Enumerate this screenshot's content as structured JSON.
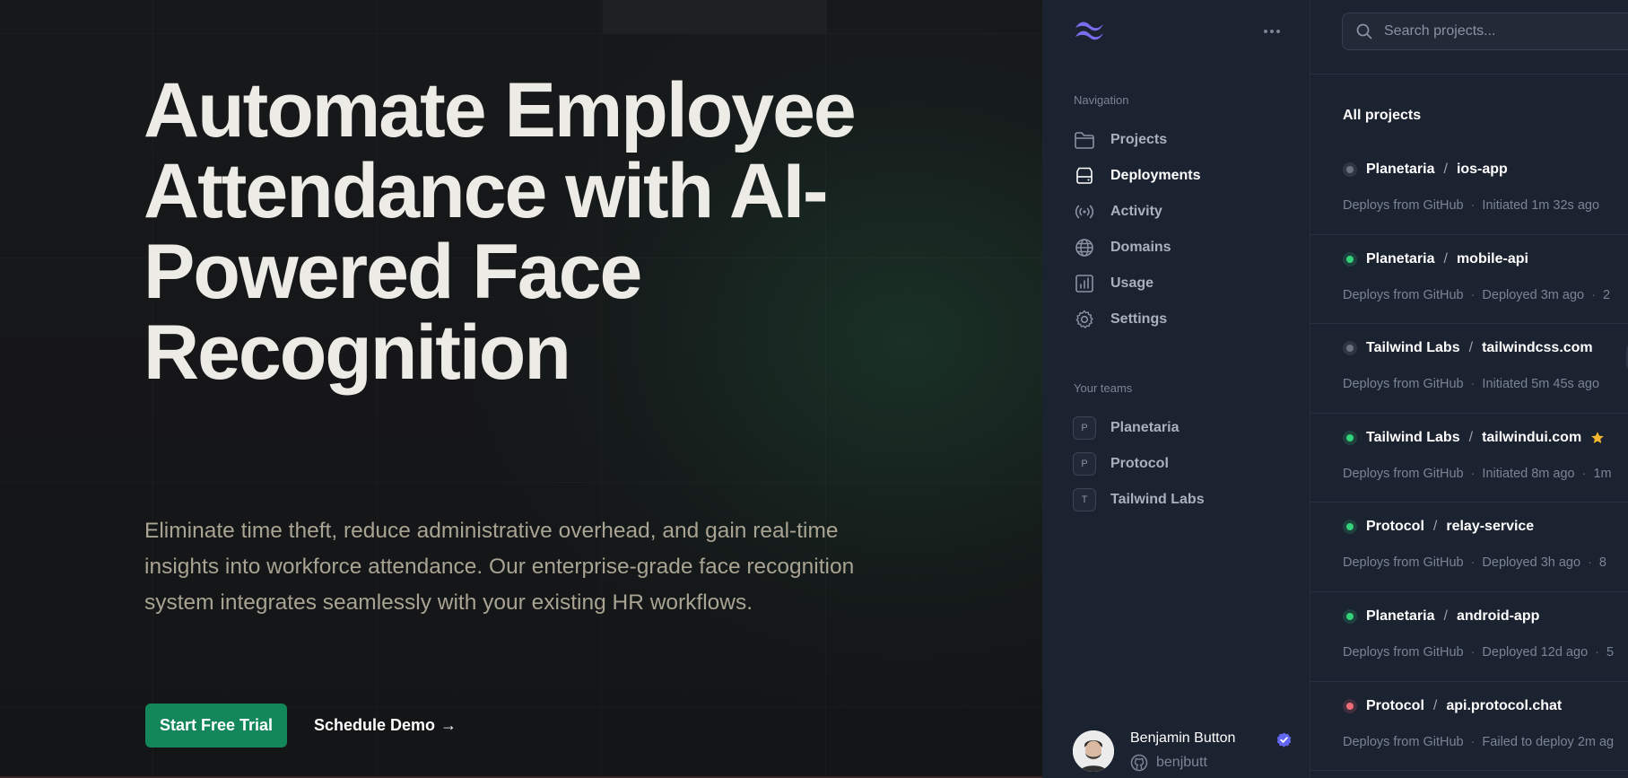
{
  "hero": {
    "title": "Automate Employee Attendance with AI-Powered Face Recognition",
    "subtitle": "Eliminate time theft, reduce administrative overhead, and gain real-time insights into workforce attendance. Our enterprise-grade face recognition system integrates seamlessly with your existing HR workflows.",
    "primary_cta": "Start Free Trial",
    "secondary_cta": "Schedule Demo",
    "secondary_cta_arrow": "→"
  },
  "sidebar": {
    "navigation_label": "Navigation",
    "nav_items": [
      {
        "label": "Projects",
        "icon": "folder-icon"
      },
      {
        "label": "Deployments",
        "icon": "server-icon",
        "active": true
      },
      {
        "label": "Activity",
        "icon": "signal-icon"
      },
      {
        "label": "Domains",
        "icon": "globe-icon"
      },
      {
        "label": "Usage",
        "icon": "chart-icon"
      },
      {
        "label": "Settings",
        "icon": "gear-icon"
      }
    ],
    "teams_label": "Your teams",
    "teams": [
      {
        "initial": "P",
        "name": "Planetaria"
      },
      {
        "initial": "P",
        "name": "Protocol"
      },
      {
        "initial": "T",
        "name": "Tailwind Labs"
      }
    ],
    "profile": {
      "name": "Benjamin Button",
      "handle": "benjbutt"
    }
  },
  "main": {
    "search_placeholder": "Search projects...",
    "heading": "All projects",
    "projects": [
      {
        "team": "Planetaria",
        "name": "ios-app",
        "status": "inactive",
        "source": "Deploys from GitHub",
        "detail": "Initiated 1m 32s ago",
        "extra": ""
      },
      {
        "team": "Planetaria",
        "name": "mobile-api",
        "status": "success",
        "source": "Deploys from GitHub",
        "detail": "Deployed 3m ago",
        "extra": "2"
      },
      {
        "team": "Tailwind Labs",
        "name": "tailwindcss.com",
        "status": "inactive",
        "source": "Deploys from GitHub",
        "detail": "Initiated 5m 45s ago",
        "extra": ""
      },
      {
        "team": "Tailwind Labs",
        "name": "tailwindui.com",
        "status": "success",
        "starred": true,
        "source": "Deploys from GitHub",
        "detail": "Initiated 8m ago",
        "extra": "1m"
      },
      {
        "team": "Protocol",
        "name": "relay-service",
        "status": "success",
        "source": "Deploys from GitHub",
        "detail": "Deployed 3h ago",
        "extra": "8"
      },
      {
        "team": "Planetaria",
        "name": "android-app",
        "status": "success",
        "source": "Deploys from GitHub",
        "detail": "Deployed 12d ago",
        "extra": "5"
      },
      {
        "team": "Protocol",
        "name": "api.protocol.chat",
        "status": "error",
        "source": "Deploys from GitHub",
        "detail": "Failed to deploy 2m ag",
        "extra": ""
      }
    ]
  },
  "colors": {
    "accent_green": "#13875a",
    "status_success": "#34d27a",
    "status_inactive": "#6b7280",
    "status_error": "#f06b78",
    "star": "#f5b82e",
    "verified": "#6366f1",
    "logo": "#7c6cf0"
  }
}
